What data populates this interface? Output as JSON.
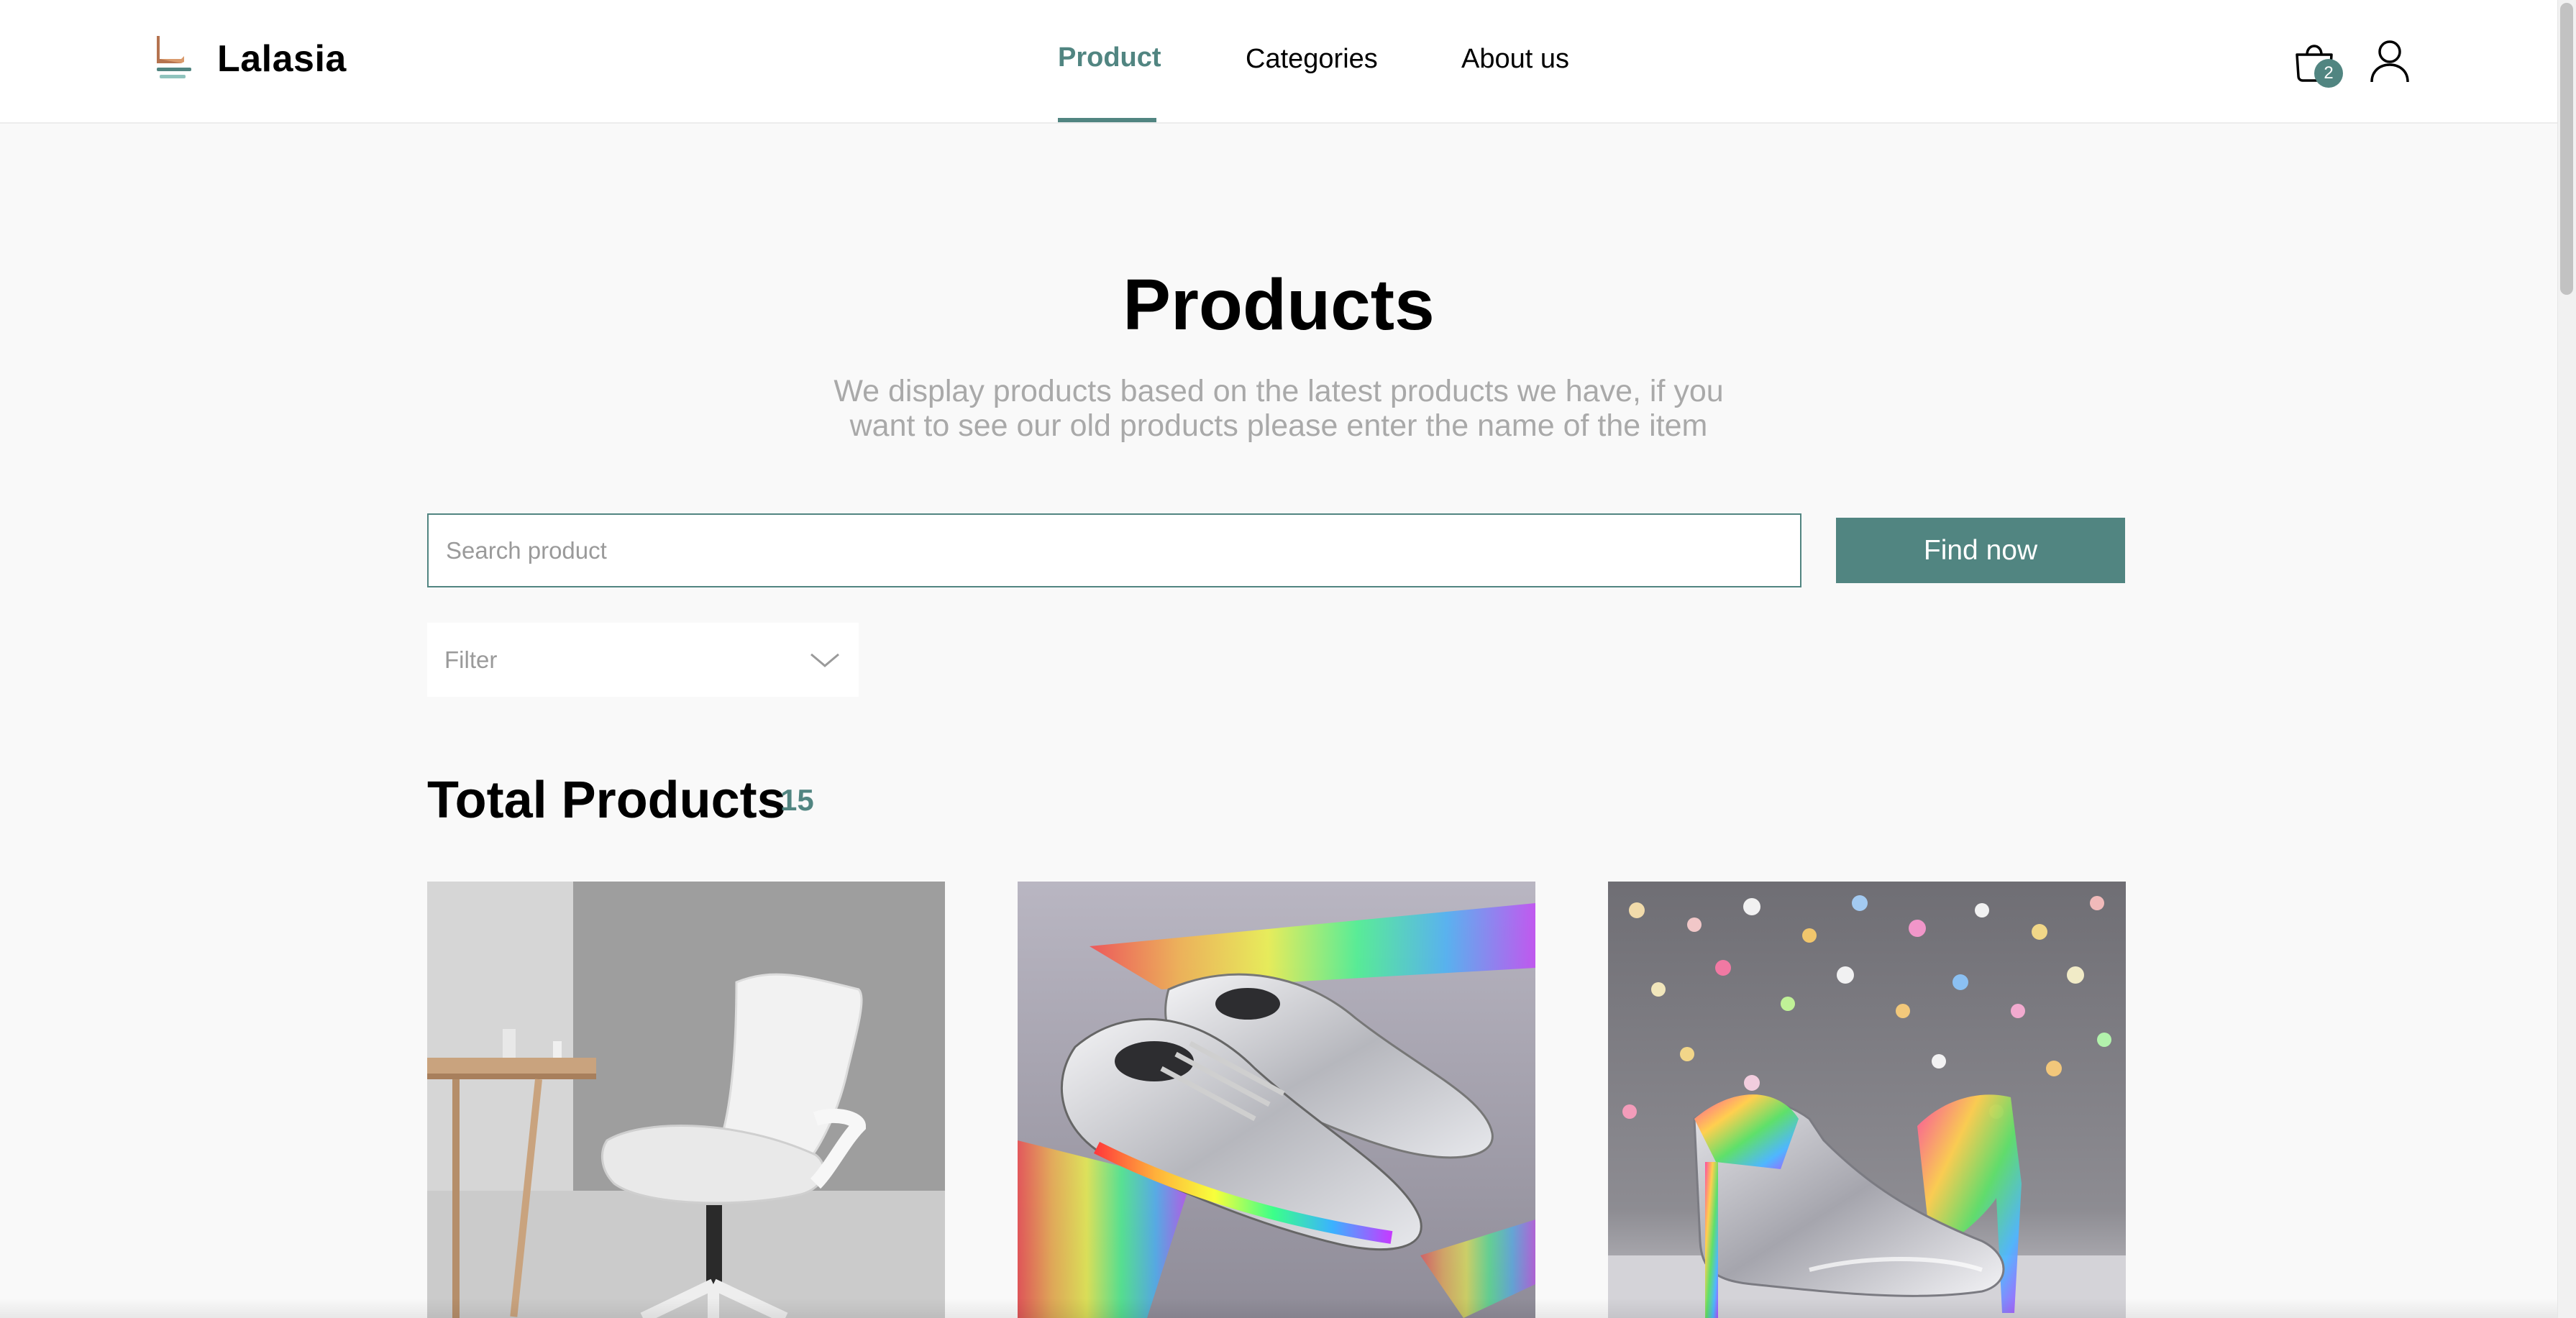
{
  "header": {
    "brand": "Lalasia",
    "nav": [
      {
        "label": "Product",
        "active": true
      },
      {
        "label": "Categories",
        "active": false
      },
      {
        "label": "About us",
        "active": false
      }
    ],
    "cart_count": "2",
    "icons": [
      "chair-logo-icon",
      "shopping-bag-icon",
      "user-icon"
    ]
  },
  "hero": {
    "title": "Products",
    "subtitle": "We display products based on the latest products we have, if you want to see our old products please enter the name of the item"
  },
  "search": {
    "placeholder": "Search product",
    "value": "",
    "button_label": "Find now"
  },
  "filter": {
    "label": "Filter"
  },
  "totals": {
    "label": "Total Products",
    "count": "15"
  },
  "colors": {
    "accent": "#518581",
    "muted_text": "#a9a9a9",
    "background": "#f9f9f9"
  },
  "products": [
    {
      "image": "white-office-chair-image"
    },
    {
      "image": "holographic-silver-sneakers-image"
    },
    {
      "image": "glitter-high-heels-image"
    }
  ]
}
